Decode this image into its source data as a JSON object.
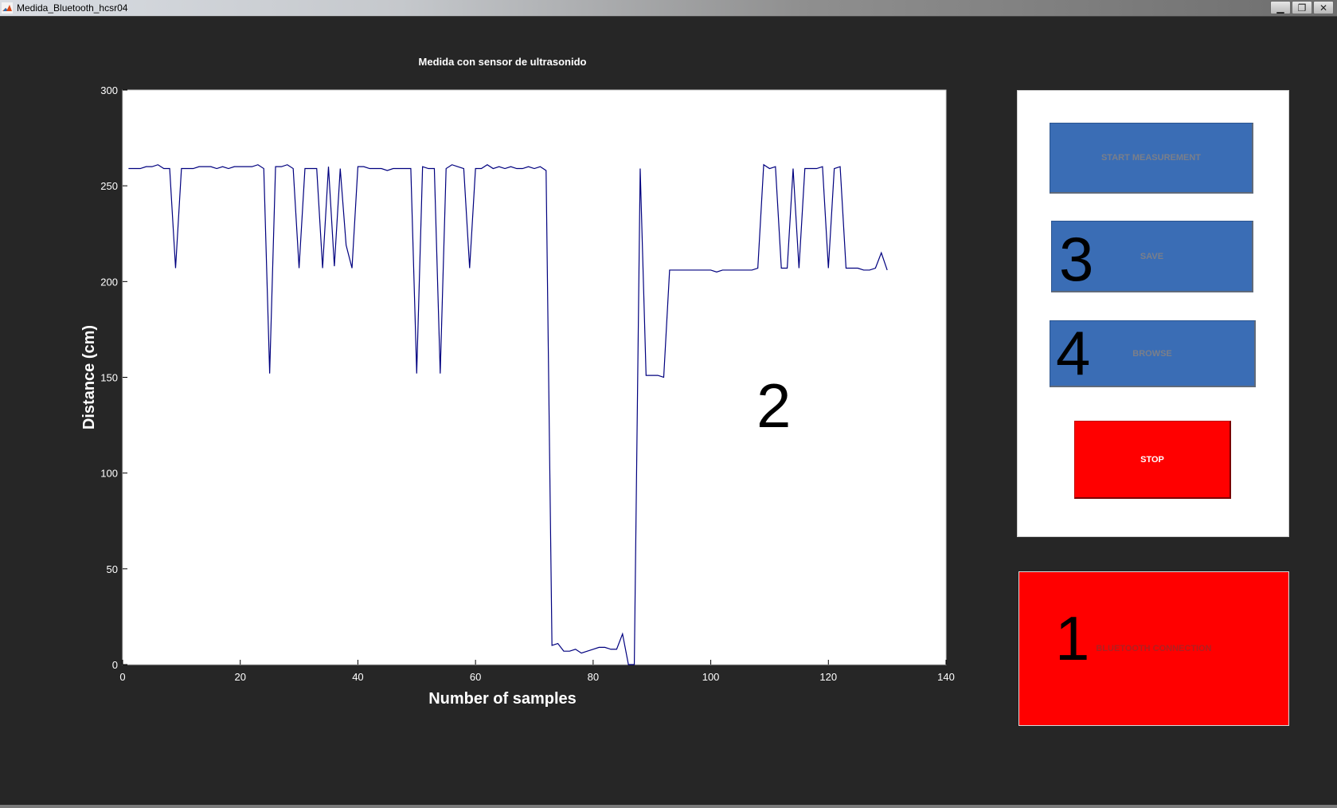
{
  "window": {
    "title": "Medida_Bluetooth_hcsr04",
    "controls": [
      "minimize",
      "restore",
      "close"
    ],
    "minimize_glyph": "▁",
    "restore_glyph": "❐",
    "close_glyph": "✕"
  },
  "buttons": {
    "start": "START MEASUREMENT",
    "save": "SAVE",
    "browse": "BROWSE",
    "stop": "STOP",
    "bluetooth": "BLUETOOTH CONNECTION"
  },
  "annotations": {
    "n1": "1",
    "n2": "2",
    "n3": "3",
    "n4": "4"
  },
  "colors": {
    "background": "#262626",
    "axes_bg": "#ffffff",
    "line": "#00007f",
    "button_blue": "#3a6db5",
    "button_red": "#ff0000"
  },
  "chart_data": {
    "type": "line",
    "title": "Medida con sensor de ultrasonido",
    "xlabel": "Number of samples",
    "ylabel": "Distance (cm)",
    "xlim": [
      0,
      140
    ],
    "ylim": [
      0,
      300
    ],
    "xticks": [
      0,
      20,
      40,
      60,
      80,
      100,
      120,
      140
    ],
    "yticks": [
      0,
      50,
      100,
      150,
      200,
      250,
      300
    ],
    "grid": false,
    "series": [
      {
        "values": [
          259,
          259,
          259,
          260,
          260,
          261,
          259,
          259,
          207,
          259,
          259,
          259,
          260,
          260,
          260,
          259,
          260,
          259,
          260,
          260,
          260,
          260,
          261,
          259,
          152,
          260,
          260,
          261,
          259,
          207,
          259,
          259,
          259,
          207,
          260,
          208,
          259,
          219,
          207,
          260,
          260,
          259,
          259,
          259,
          258,
          259,
          259,
          259,
          259,
          152,
          260,
          259,
          259,
          152,
          259,
          261,
          260,
          259,
          207,
          259,
          259,
          261,
          259,
          260,
          259,
          260,
          259,
          259,
          260,
          259,
          260,
          258,
          10,
          11,
          7,
          7,
          8,
          6,
          7,
          8,
          9,
          9,
          8,
          8,
          16,
          0,
          0,
          259,
          151,
          151,
          151,
          150,
          206,
          206,
          206,
          206,
          206,
          206,
          206,
          206,
          205,
          206,
          206,
          206,
          206,
          206,
          206,
          207,
          261,
          259,
          260,
          207,
          207,
          259,
          207,
          259,
          259,
          259,
          260,
          207,
          259,
          260,
          207,
          207,
          207,
          206,
          206,
          207,
          215,
          206
        ]
      }
    ]
  }
}
